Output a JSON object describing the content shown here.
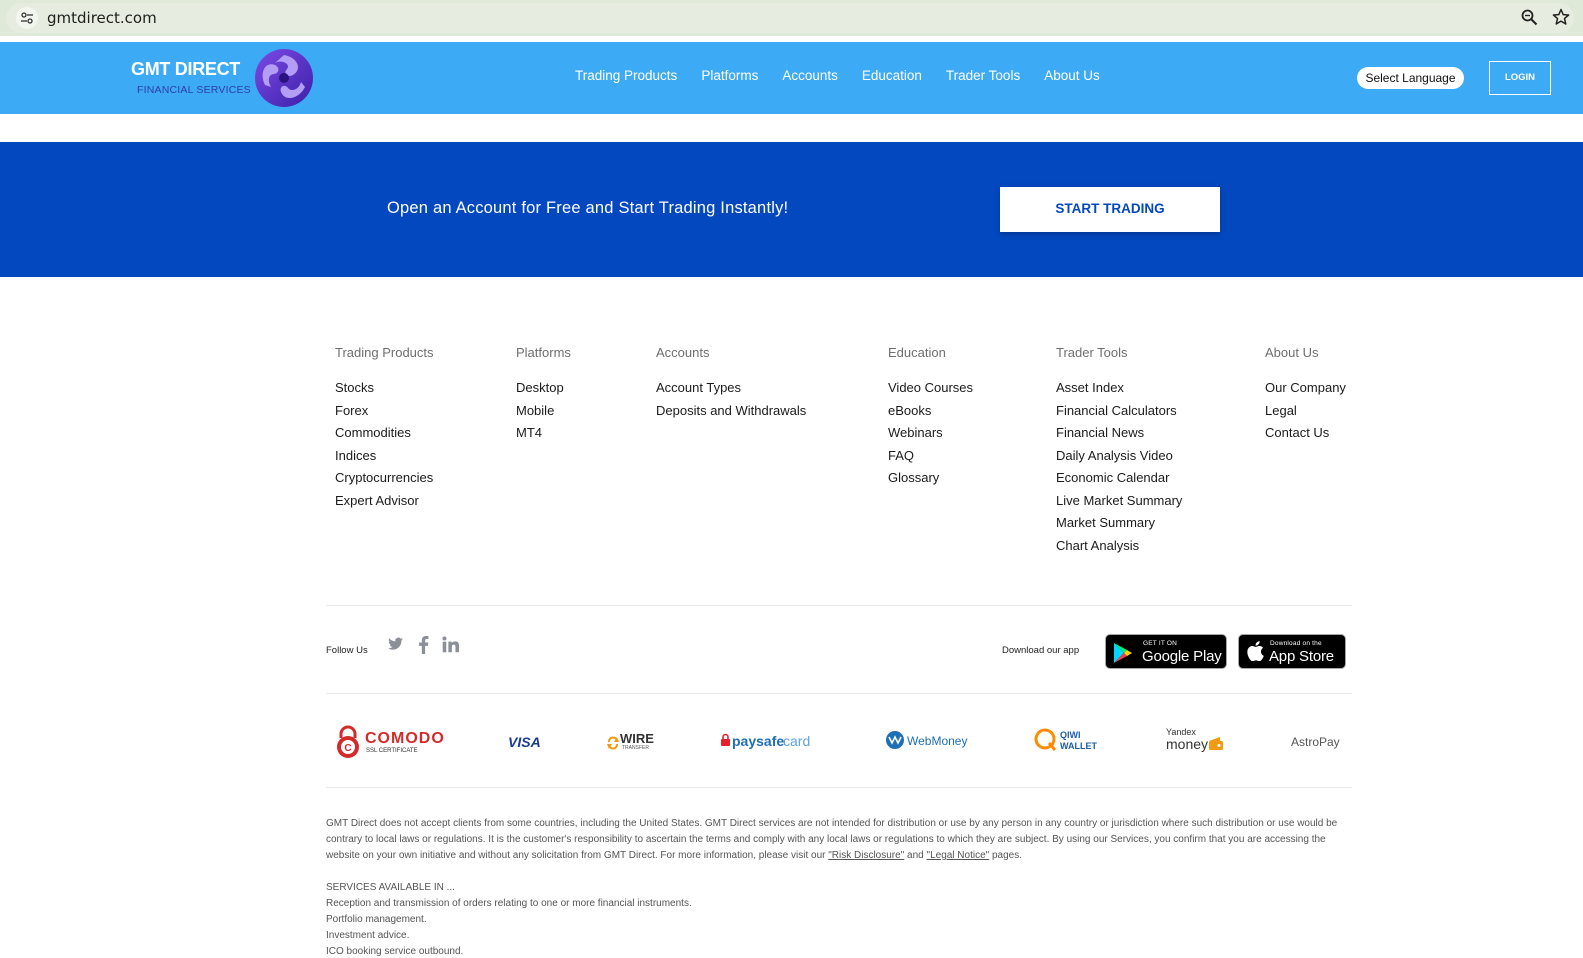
{
  "browser": {
    "url": "gmtdirect.com"
  },
  "header": {
    "logo_title": "GMT DIRECT",
    "logo_subtitle": "FINANCIAL SERVICES",
    "nav": [
      "Trading Products",
      "Platforms",
      "Accounts",
      "Education",
      "Trader Tools",
      "About Us"
    ],
    "language_button": "Select Language",
    "login_button": "LOGIN"
  },
  "banner": {
    "text": "Open an Account for Free and Start Trading Instantly!",
    "cta": "START TRADING"
  },
  "footer_columns": [
    {
      "title": "Trading Products",
      "links": [
        "Stocks",
        "Forex",
        "Commodities",
        "Indices",
        "Cryptocurrencies",
        "Expert Advisor"
      ]
    },
    {
      "title": "Platforms",
      "links": [
        "Desktop",
        "Mobile",
        "MT4"
      ]
    },
    {
      "title": "Accounts",
      "links": [
        "Account Types",
        "Deposits and Withdrawals"
      ]
    },
    {
      "title": "Education",
      "links": [
        "Video Courses",
        "eBooks",
        "Webinars",
        "FAQ",
        "Glossary"
      ]
    },
    {
      "title": "Trader Tools",
      "links": [
        "Asset Index",
        "Financial Calculators",
        "Financial News",
        "Daily Analysis Video",
        "Economic Calendar",
        "Live Market Summary",
        "Market Summary",
        "Chart Analysis"
      ]
    },
    {
      "title": "About Us",
      "links": [
        "Our Company",
        "Legal",
        "Contact Us"
      ]
    }
  ],
  "follow": {
    "label": "Follow Us",
    "icons": [
      "twitter-icon",
      "facebook-icon",
      "linkedin-icon"
    ]
  },
  "apps": {
    "label": "Download our app",
    "google_small": "GET IT ON",
    "google_big": "Google Play",
    "apple_small": "Download on the",
    "apple_big": "App Store"
  },
  "payments": {
    "comodo": "COMODO",
    "comodo_sub": "SSL CERTIFICATE",
    "visa": "VISA",
    "wire": "WIRE",
    "wire_sub": "TRANSFER",
    "paysafe_a": "paysafe",
    "paysafe_b": "card",
    "webmoney": "WebMoney",
    "qiwi_a": "QIWI",
    "qiwi_b": "WALLET",
    "yandex_a": "Yandex",
    "yandex_b": "money",
    "astropay": "AstroPay"
  },
  "disclaimer": {
    "text_before": "GMT Direct does not accept clients from some countries, including the United States. GMT Direct services are not intended for distribution or use by any person in any country or jurisdiction where such distribution or use would be contrary to local laws or regulations. It is the customer's responsibility to ascertain the terms and comply with any local laws or regulations to which they are subject. By using our Services, you confirm that you are accessing the website on your own initiative and without any solicitation from GMT Direct. For more information, please visit our ",
    "risk_link": "\"Risk Disclosure\"",
    "and": " and ",
    "legal_link": "\"Legal Notice\"",
    "text_after": " pages."
  },
  "services": {
    "heading": "SERVICES AVAILABLE IN ...",
    "items": [
      "Reception and transmission of orders relating to one or more financial instruments.",
      "Portfolio management.",
      "Investment advice.",
      "ICO booking service outbound."
    ]
  },
  "colors": {
    "header_bg": "#3daaf5",
    "banner_bg": "#0448c0",
    "browser_bar": "#dfe9d8"
  }
}
